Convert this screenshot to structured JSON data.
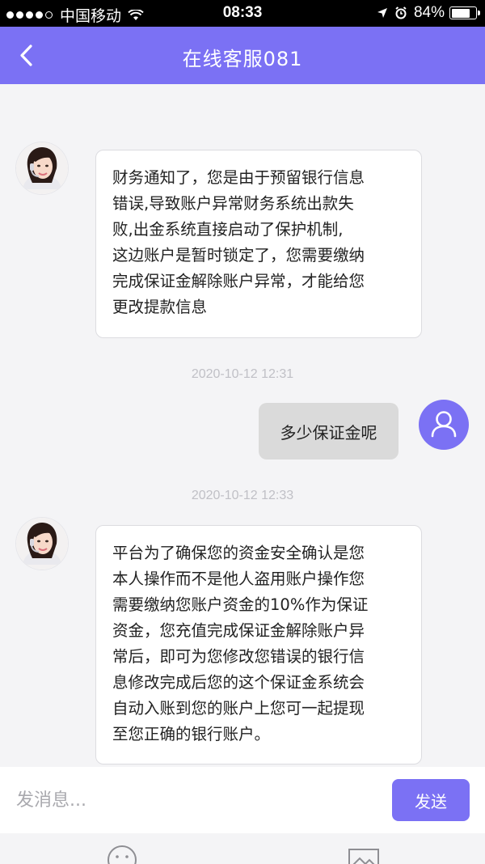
{
  "status_bar": {
    "carrier": "中国移动",
    "time": "08:33",
    "battery": "84%",
    "battery_level": 0.84,
    "signal_bars": 4
  },
  "header": {
    "title": "在线客服081",
    "back_icon": "chevron-left-icon"
  },
  "messages": [
    {
      "from": "agent",
      "lines": [
        "财务通知了，您是由于预留银行信息",
        "错误,导致账户异常财务系统出款失",
        "败,出金系统直接启动了保护机制,",
        "这边账户是暂时锁定了，您需要缴纳",
        "完成保证金解除账户异常，才能给您",
        "更改提款信息"
      ]
    },
    {
      "timestamp": "2020-10-12 12:31"
    },
    {
      "from": "user",
      "text": "多少保证金呢"
    },
    {
      "timestamp": "2020-10-12 12:33"
    },
    {
      "from": "agent",
      "lines": [
        "平台为了确保您的资金安全确认是您",
        "本人操作而不是他人盗用账户操作您",
        "需要缴纳您账户资金的10%作为保证",
        "资金，您充值完成保证金解除账户异",
        "常后，即可为您修改您错误的银行信",
        "息修改完成后您的这个保证金系统会",
        "自动入账到您的账户上您可一起提现",
        "至您正确的银行账户。"
      ]
    }
  ],
  "input": {
    "placeholder": "发消息...",
    "send_label": "发送"
  },
  "colors": {
    "accent": "#7b71f4",
    "background": "#f4f4f6",
    "bubble_in": "#ffffff",
    "bubble_out": "#dadada"
  },
  "toolbar_icons": [
    "emoji-icon",
    "image-icon"
  ]
}
